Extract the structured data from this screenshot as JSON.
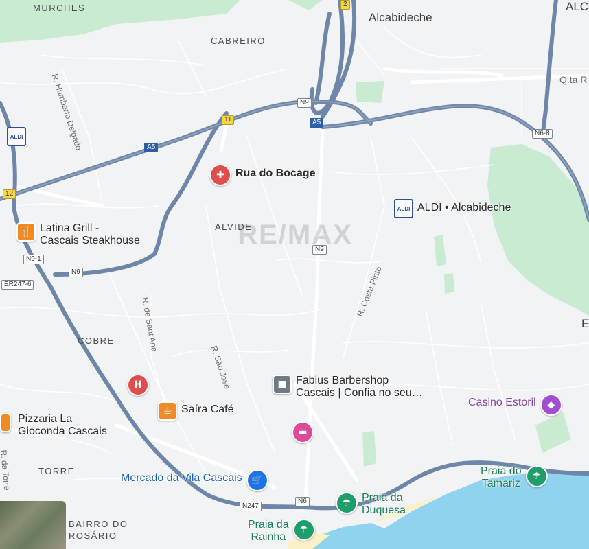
{
  "areas": {
    "murches": "MURCHES",
    "cabreiro": "CABREIRO",
    "alvide": "ALVIDE",
    "cobre": "COBRE",
    "torre": "TORRE",
    "bairro_line1": "BAIRRO DO",
    "bairro_line2": "ROSÁRIO"
  },
  "towns": {
    "alcabideche": "Alcabideche",
    "alc_partial": "ALC",
    "e_partial": "E"
  },
  "streets": {
    "humberto": "R. Humberto Delgado",
    "santana": "R. de Sant'Ana",
    "saojose": "R. São José",
    "costapinto": "R. Costa Pinto",
    "datorre": "R. da Torre",
    "qta": "Q.ta R"
  },
  "shields": {
    "n9_top": "N9",
    "a5_top": "A5",
    "a5_left": "A5",
    "r11": "11",
    "r12": "12",
    "r2": "2",
    "n6_8": "N6-8",
    "n9_mid": "N9",
    "n9_1": "N9-1",
    "n9_left": "N9",
    "er247_6": "ER247-6",
    "n247": "N247",
    "n6": "N6"
  },
  "pois": {
    "rua_bocage": "Rua do Bocage",
    "aldi_alcabideche": "ALDI • Alcabideche",
    "latina_line1": "Latina Grill -",
    "latina_line2": "Cascais Steakhouse",
    "fabius_line1": "Fabius Barbershop",
    "fabius_line2": "Cascais | Confia no seu…",
    "saira": "Saíra Café",
    "pizzaria_line1": "Pizzaria La",
    "pizzaria_line2": "Gioconda Cascais",
    "casino": "Casino Estoril",
    "mercado": "Mercado da Vila Cascais",
    "duquesa_line1": "Praia da",
    "duquesa_line2": "Duquesa",
    "rainha_line1": "Praia da",
    "rainha_line2": "Rainha",
    "tamariz_line1": "Praia do",
    "tamariz_line2": "Tamariz",
    "aldi_logo": "ALDI",
    "watermark": "RE/MAX"
  },
  "colors": {
    "land": "#f2f3f5",
    "park": "#c8ebd2",
    "water": "#8fd3ef",
    "highway": "#6e86a8",
    "road": "#ffffff",
    "beach": "#fbf1c7",
    "hospital_red": "#e04d4d",
    "food_orange": "#f08a24",
    "shopping_blue": "#1a73e8",
    "beach_green": "#1e9e6a",
    "hotel_pink": "#e0489a",
    "casino_purple": "#a14fd0",
    "generic_gray": "#6f7a86"
  }
}
